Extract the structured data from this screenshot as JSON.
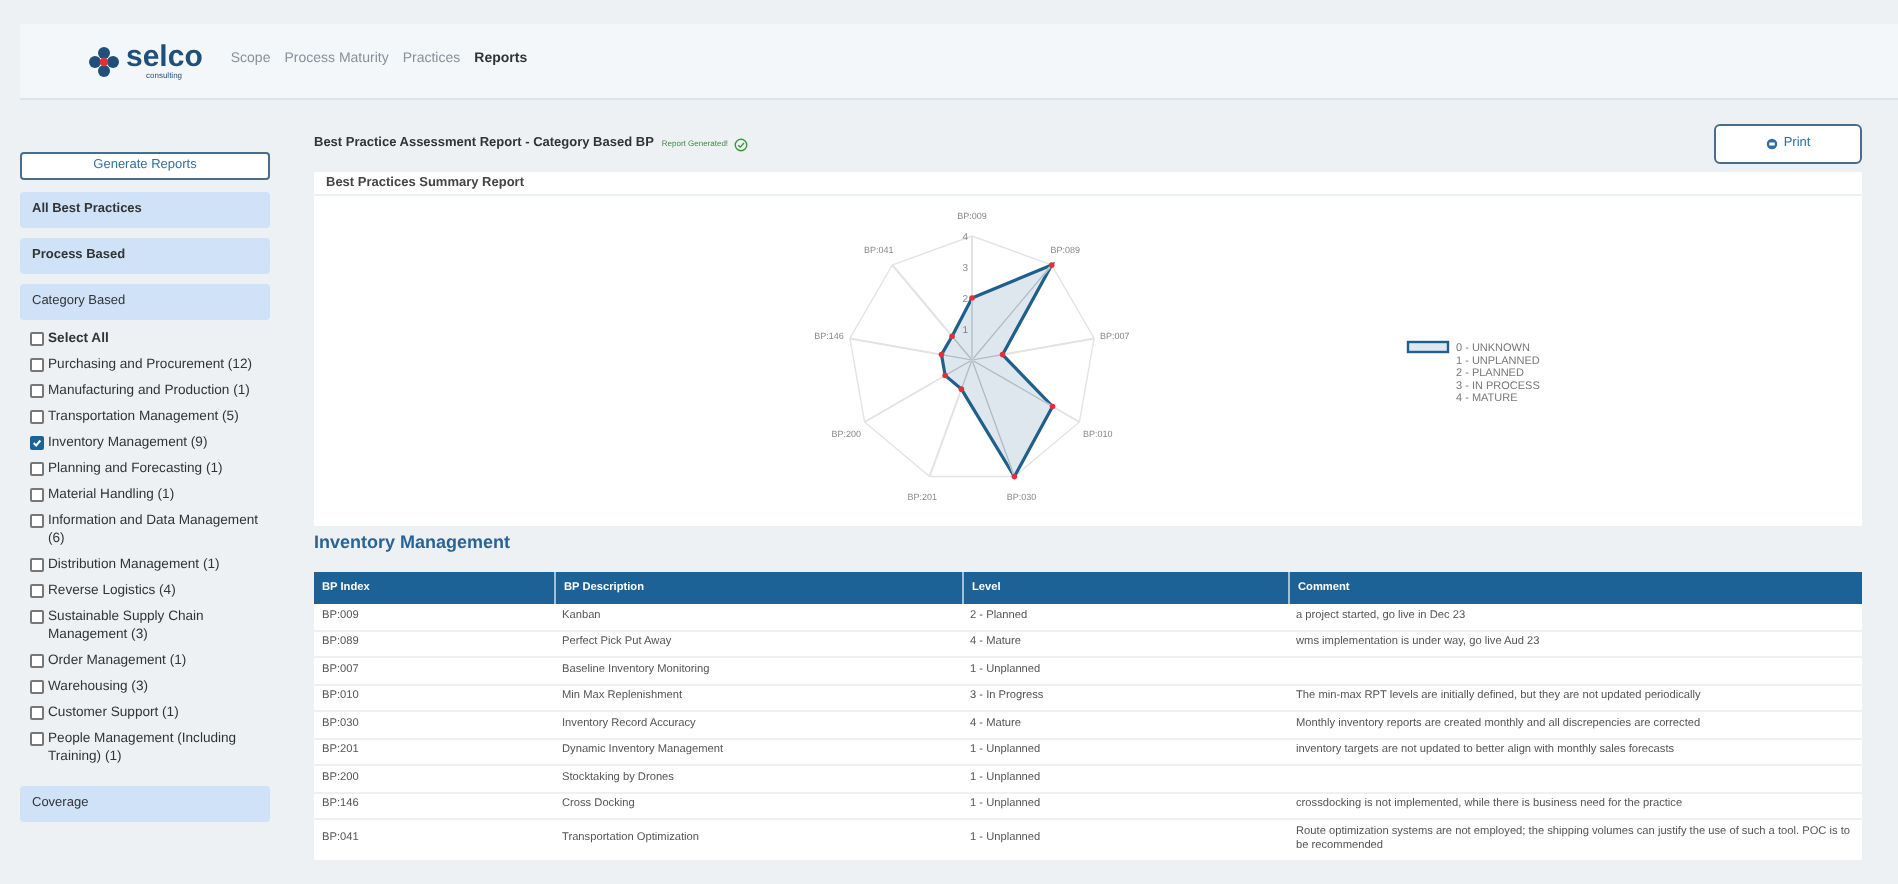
{
  "logo": {
    "name": "selco",
    "tagline": "consulting"
  },
  "nav": [
    {
      "label": "Scope",
      "selected": false
    },
    {
      "label": "Process Maturity",
      "selected": false
    },
    {
      "label": "Practices",
      "selected": false
    },
    {
      "label": "Reports",
      "selected": true
    }
  ],
  "sidebar": {
    "generate_button": "Generate Reports",
    "sections": [
      {
        "label": "All Best Practices",
        "bold": true
      },
      {
        "label": "Process Based",
        "bold": true
      },
      {
        "label": "Category Based",
        "bold": false
      }
    ],
    "checkboxes": [
      {
        "label": "Select All",
        "checked": false,
        "bold": true
      },
      {
        "label": "Purchasing and Procurement (12)",
        "checked": false,
        "bold": false
      },
      {
        "label": "Manufacturing and Production (1)",
        "checked": false,
        "bold": false
      },
      {
        "label": "Transportation Management (5)",
        "checked": false,
        "bold": false
      },
      {
        "label": "Inventory Management (9)",
        "checked": true,
        "bold": false
      },
      {
        "label": "Planning and Forecasting (1)",
        "checked": false,
        "bold": false
      },
      {
        "label": "Material Handling (1)",
        "checked": false,
        "bold": false
      },
      {
        "label": "Information and Data Management (6)",
        "checked": false,
        "bold": false
      },
      {
        "label": "Distribution Management (1)",
        "checked": false,
        "bold": false
      },
      {
        "label": "Reverse Logistics (4)",
        "checked": false,
        "bold": false
      },
      {
        "label": "Sustainable Supply Chain Management (3)",
        "checked": false,
        "bold": false
      },
      {
        "label": "Order Management (1)",
        "checked": false,
        "bold": false
      },
      {
        "label": "Warehousing (3)",
        "checked": false,
        "bold": false
      },
      {
        "label": "Customer Support (1)",
        "checked": false,
        "bold": false
      },
      {
        "label": "People Management (Including Training) (1)",
        "checked": false,
        "bold": false
      }
    ],
    "footer_section": {
      "label": "Coverage"
    }
  },
  "report": {
    "title": "Best Practice Assessment Report - Category Based BP",
    "status": "Report Generated!",
    "print_button": "Print",
    "summary": {
      "title": "Best Practices Summary Report",
      "radar": {
        "ticks": [
          "4",
          "3",
          "2",
          "1"
        ],
        "axes": [
          {
            "label": "BP:009",
            "level": 0.5
          },
          {
            "label": "BP:089",
            "level": 1
          },
          {
            "label": "BP:007",
            "level": 0.25
          },
          {
            "label": "BP:010",
            "level": 0.75
          },
          {
            "label": "BP:030",
            "level": 1
          },
          {
            "label": "BP:201",
            "level": 0.25
          },
          {
            "label": "BP:200",
            "level": 0.25
          },
          {
            "label": "BP:146",
            "level": 0.25
          },
          {
            "label": "BP:041",
            "level": 0.25
          }
        ],
        "legend": [
          "0 - UNKNOWN",
          "1 - UNPLANNED",
          "2 - PLANNED",
          "3 - IN PROCESS",
          "4 - MATURE"
        ]
      }
    },
    "table": {
      "title": "Inventory Management",
      "columns": [
        "BP Index",
        "BP Description",
        "Level",
        "Comment"
      ],
      "rows": [
        [
          "BP:009",
          "Kanban",
          "2 - Planned",
          "a project started, go live in Dec 23"
        ],
        [
          "BP:089",
          "Perfect Pick Put Away",
          "4 - Mature",
          "wms implementation is under way, go live Aud 23"
        ],
        [
          "BP:007",
          "Baseline Inventory Monitoring",
          "1 - Unplanned",
          ""
        ],
        [
          "BP:010",
          "Min Max Replenishment",
          "3 - In Progress",
          "The min-max RPT levels are initially defined, but they are not updated periodically"
        ],
        [
          "BP:030",
          "Inventory Record Accuracy",
          "4 - Mature",
          "Monthly inventory reports are created monthly and all discrepencies are corrected"
        ],
        [
          "BP:201",
          "Dynamic Inventory Management",
          "1 - Unplanned",
          "inventory targets are not updated to better align with monthly sales forecasts"
        ],
        [
          "BP:200",
          "Stocktaking by Drones",
          "1 - Unplanned",
          ""
        ],
        [
          "BP:146",
          "Cross Docking",
          "1 - Unplanned",
          "crossdocking is not implemented, while there is business need for the practice"
        ],
        [
          "BP:041",
          "Transportation Optimization",
          "1 - Unplanned",
          "Route optimization systems are not employed; the shipping volumes can justify the use of such a tool. POC is to be recommended"
        ]
      ]
    }
  }
}
